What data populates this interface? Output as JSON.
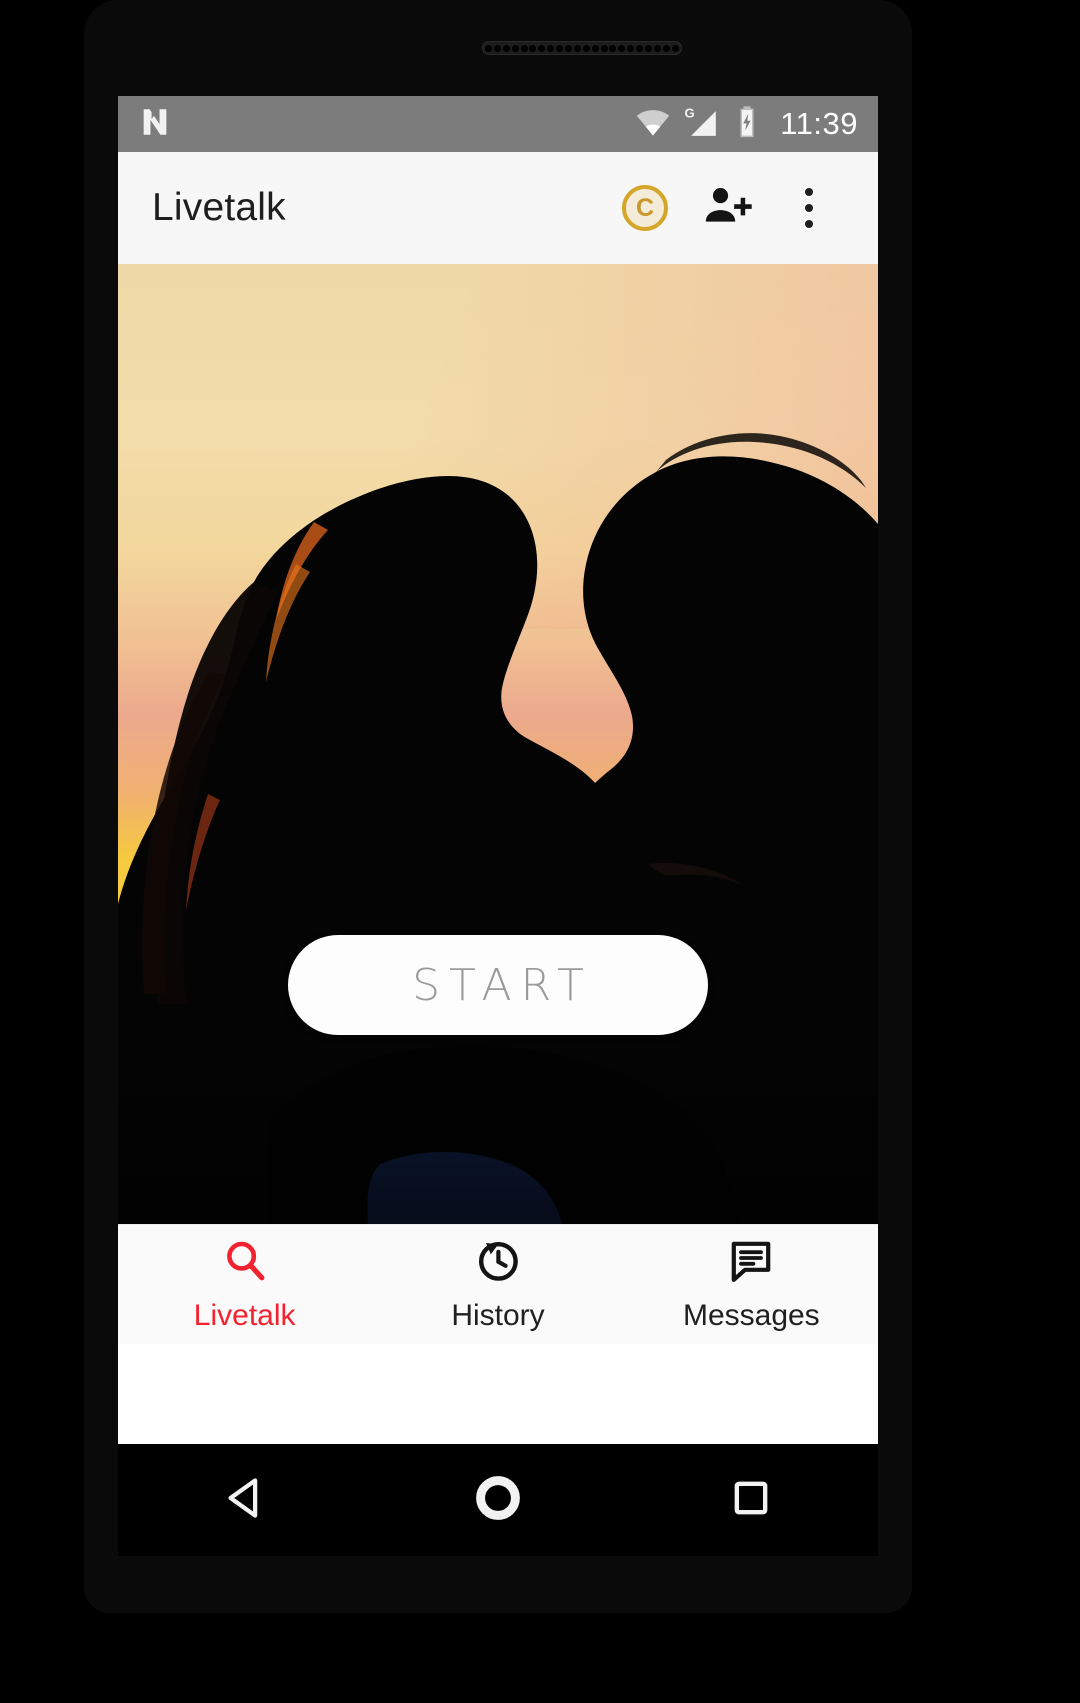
{
  "status_bar": {
    "notification_icon": "android-n-logo-icon",
    "wifi_icon": "wifi-icon",
    "network_label": "G",
    "signal_icon": "cell-signal-icon",
    "battery_icon": "battery-charging-icon",
    "time": "11:39",
    "background": "#7c7c7c"
  },
  "app_bar": {
    "title": "Livetalk",
    "coin_label": "C",
    "coin_color": "#d4a62a",
    "add_person_icon": "person-add-icon",
    "overflow_icon": "more-vertical-icon",
    "background": "#f7f7f7"
  },
  "main": {
    "hero_photo_alt": "silhouette-couple-sunset",
    "start_button_label": "START"
  },
  "bottom_nav": {
    "active_color": "#f3222e",
    "items": [
      {
        "label": "Livetalk",
        "icon": "search-icon",
        "active": true
      },
      {
        "label": "History",
        "icon": "history-icon",
        "active": false
      },
      {
        "label": "Messages",
        "icon": "message-icon",
        "active": false
      }
    ]
  },
  "system_nav": {
    "back_icon": "back-triangle-icon",
    "home_icon": "home-circle-icon",
    "recents_icon": "recents-square-icon"
  }
}
